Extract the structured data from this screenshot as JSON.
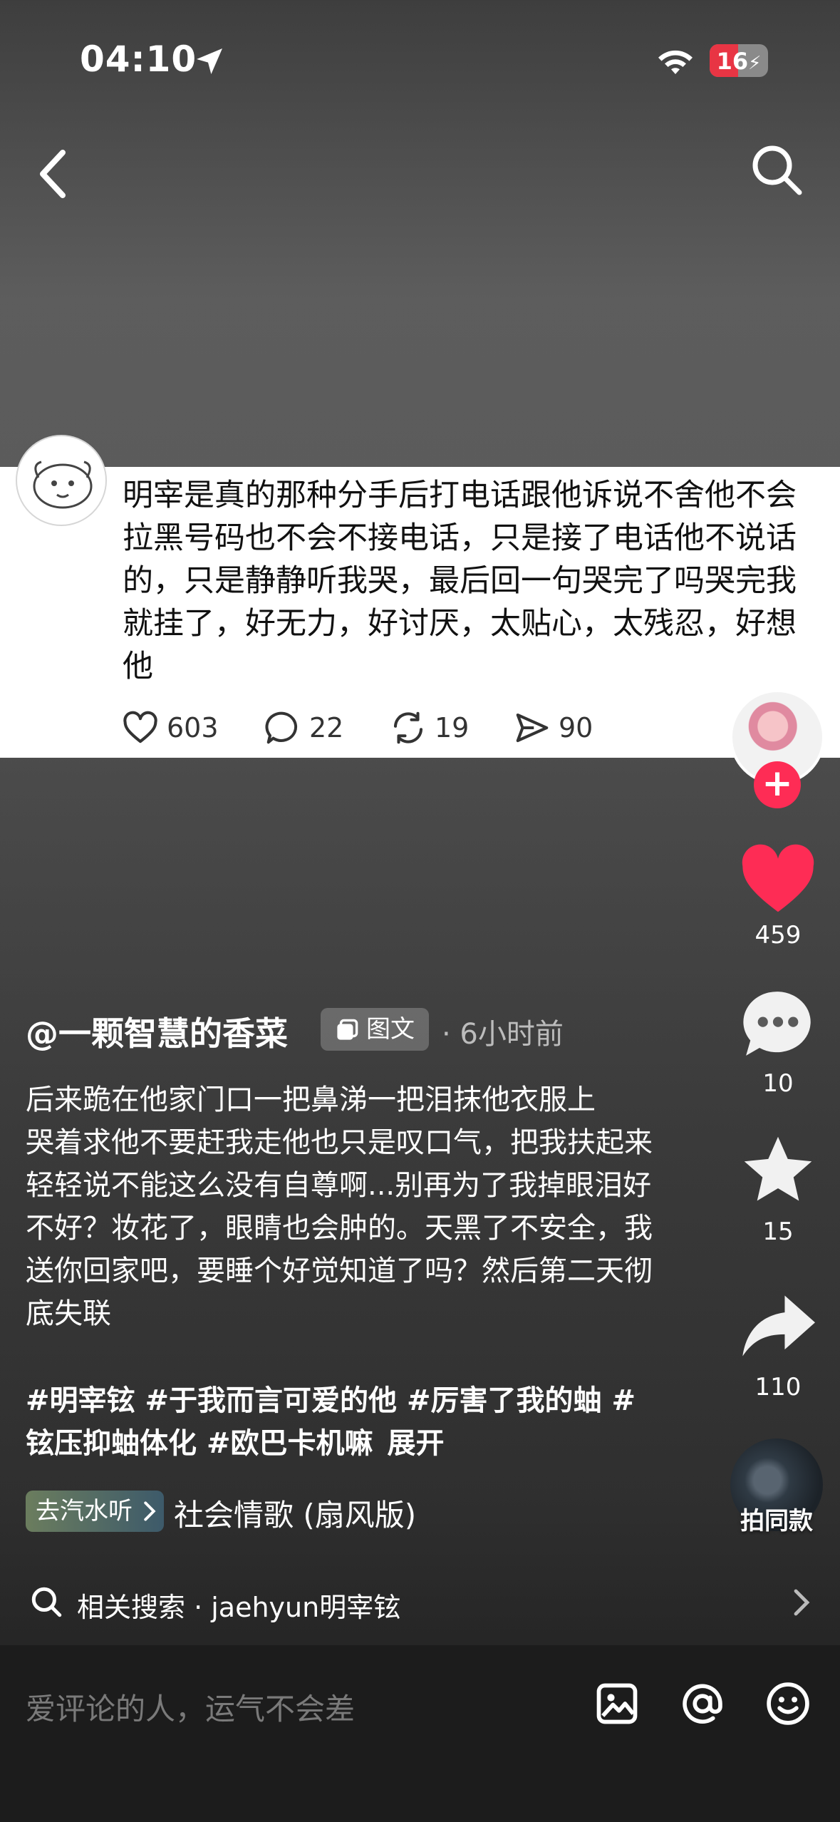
{
  "status_bar": {
    "time": "04:10",
    "battery": "16"
  },
  "card": {
    "text": "明宰是真的那种分手后打电话跟他诉说不舍他不会拉黑号码也不会不接电话，只是接了电话他不说话的，只是静静听我哭，最后回一句哭完了吗哭完我就挂了，好无力，好讨厌，太贴心，太残忍，好想他",
    "stats": {
      "likes": "603",
      "comments": "22",
      "reposts": "19",
      "shares": "90"
    }
  },
  "rail": {
    "likes": "459",
    "comments": "10",
    "favorites": "15",
    "shares": "110",
    "music_label": "拍同款",
    "accent": "#fe2c55"
  },
  "post": {
    "author": "@一颗智慧的香菜",
    "badge": "图文",
    "time_ago": "· 6小时前",
    "caption": "后来跪在他家门口一把鼻涕一把泪抹他衣服上\n哭着求他不要赶我走他也只是叹口气，把我扶起来轻轻说不能这么没有自尊啊...别再为了我掉眼泪好不好？妆花了，眼睛也会肿的。天黑了不安全，我送你回家吧，要睡个好觉知道了吗？然后第二天彻底失联",
    "tags": [
      "#明宰铉",
      "#于我而言可爱的他",
      "#厉害了我的蚰",
      "#铉压抑蚰体化",
      "#欧巴卡机嘛"
    ],
    "expand": "展开"
  },
  "music": {
    "pill": "去汽水听",
    "song": "社会情歌 (扇风版)"
  },
  "related": {
    "label": "相关搜索 · jaehyun明宰铉"
  },
  "comment_bar": {
    "placeholder": "爱评论的人，运气不会差"
  }
}
